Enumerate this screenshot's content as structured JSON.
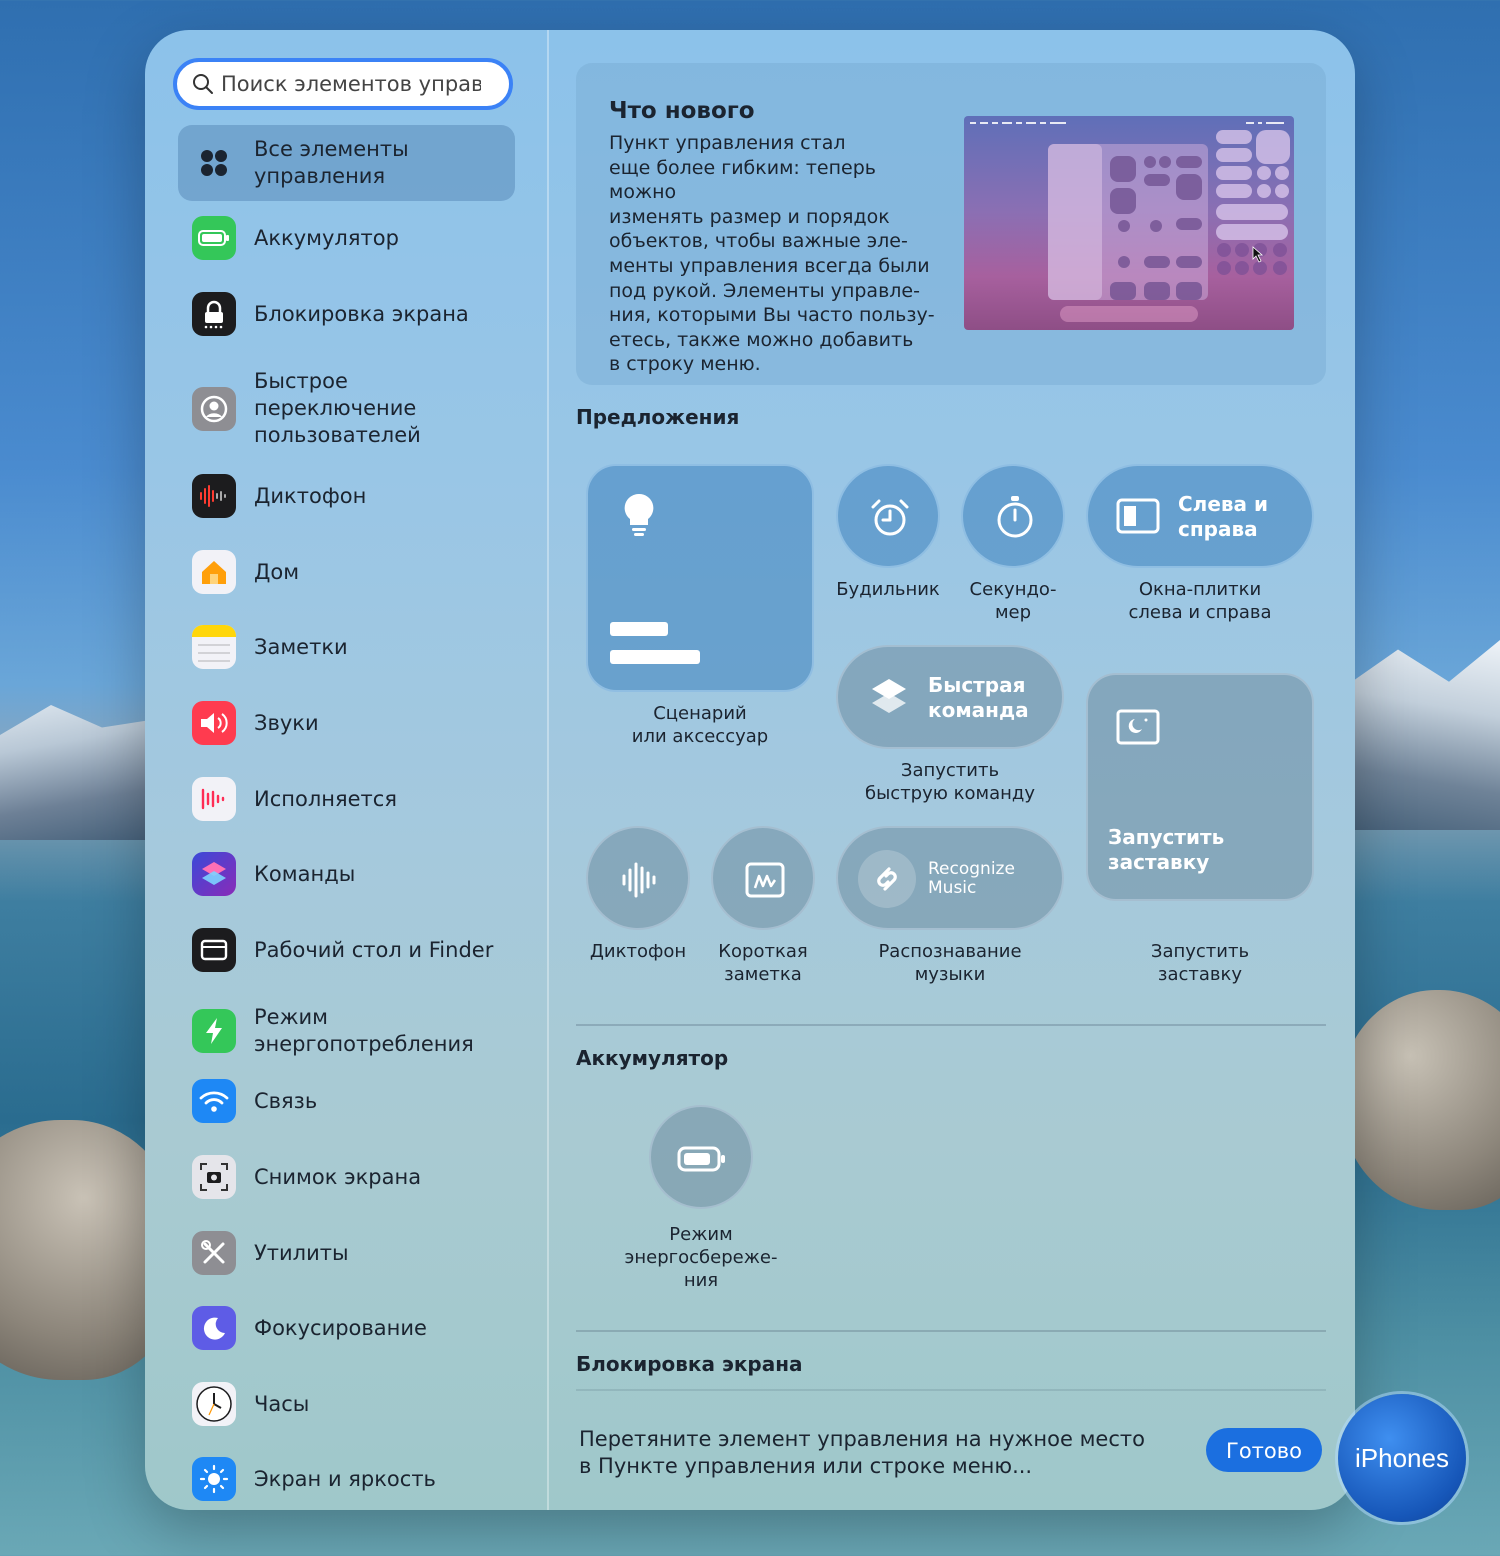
{
  "search": {
    "placeholder": "Поиск элементов управ."
  },
  "sidebar": {
    "items": [
      {
        "label": "Все элементы управления",
        "icon": "grid-dots-icon",
        "color": "transparent"
      },
      {
        "label": "Аккумулятор",
        "icon": "battery-icon",
        "color": "#34c759"
      },
      {
        "label": "Блокировка экрана",
        "icon": "lock-icon",
        "color": "#1c1c1e"
      },
      {
        "label": "Быстрое переключение пользователей",
        "icon": "user-circle-icon",
        "color": "#8e8e93"
      },
      {
        "label": "Диктофон",
        "icon": "waveform-icon",
        "color": "#1c1c1e"
      },
      {
        "label": "Дом",
        "icon": "home-icon",
        "color": "#f2f2f7"
      },
      {
        "label": "Заметки",
        "icon": "notes-icon",
        "color": "#f2f2f7"
      },
      {
        "label": "Звуки",
        "icon": "speaker-icon",
        "color": "#ff3b4f"
      },
      {
        "label": "Исполняется",
        "icon": "now-playing-icon",
        "color": "#f2f2f7"
      },
      {
        "label": "Команды",
        "icon": "shortcuts-icon",
        "color": "#3d2b8f"
      },
      {
        "label": "Рабочий стол и Finder",
        "icon": "desktop-icon",
        "color": "#1c1c1e"
      },
      {
        "label": "Режим энергопотребления",
        "icon": "bolt-icon",
        "color": "#34c759"
      },
      {
        "label": "Связь",
        "icon": "wifi-icon",
        "color": "#1e88f5"
      },
      {
        "label": "Снимок экрана",
        "icon": "screenshot-icon",
        "color": "#e5e5ea"
      },
      {
        "label": "Утилиты",
        "icon": "tools-icon",
        "color": "#8e8e93"
      },
      {
        "label": "Фокусирование",
        "icon": "moon-icon",
        "color": "#5e5ce6"
      },
      {
        "label": "Часы",
        "icon": "clock-icon",
        "color": "#f2f2f7"
      },
      {
        "label": "Экран и яркость",
        "icon": "sun-icon",
        "color": "#1e88f5"
      }
    ]
  },
  "whats_new": {
    "title": "Что нового",
    "body": "Пункт управления стал\nеще более гибким: теперь можно\nизменять размер и порядок\nобъектов, чтобы важные эле-\nменты управления всегда были\nпод рукой. Элементы управле-\nния, которыми Вы часто пользу-\nетесь, также можно добавить\nв строку меню."
  },
  "suggestions": {
    "title": "Предложения",
    "scene": {
      "caption": "Сценарий\nили аксессуар"
    },
    "alarm": {
      "caption": "Будильник"
    },
    "stopwatch": {
      "caption": "Секундо-\nмер"
    },
    "tile_left_right": {
      "label": "Слева и\nсправа",
      "caption": "Окна-плитки\nслева и справа"
    },
    "quick_command": {
      "label": "Быстрая\nкоманда",
      "caption": "Запустить\nбыструю команду"
    },
    "screensaver": {
      "label": "Запустить\nзаставку",
      "caption": "Запустить\nзаставку"
    },
    "dictaphone": {
      "caption": "Диктофон"
    },
    "quick_note": {
      "caption": "Короткая\nзаметка"
    },
    "recognize": {
      "label": "Recognize\nMusic",
      "caption": "Распознавание\nмузыки"
    }
  },
  "battery_section": {
    "title": "Аккумулятор",
    "low_power": {
      "caption": "Режим\nэнергосбереже-\nния"
    }
  },
  "lock_section": {
    "title": "Блокировка экрана"
  },
  "footer": {
    "hint": "Перетяните элемент управления на нужное место\nв Пункте управления или строке меню...",
    "done_label": "Готово"
  },
  "watermark": "iPhones"
}
